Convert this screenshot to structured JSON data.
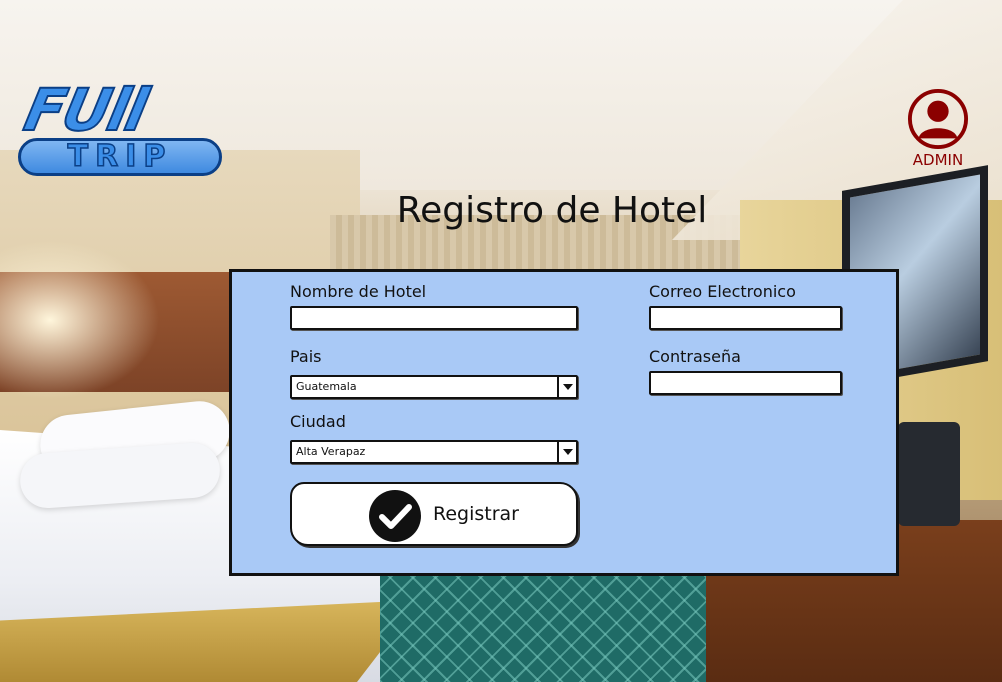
{
  "logo": {
    "line1": "FUll",
    "line2": "TRIP"
  },
  "admin": {
    "label": "ADMIN",
    "color": "#8b0000"
  },
  "page": {
    "title": "Registro de Hotel"
  },
  "form": {
    "hotel_name_label": "Nombre de Hotel",
    "hotel_name_value": "",
    "country_label": "Pais",
    "country_value": "Guatemala",
    "city_label": "Ciudad",
    "city_value": "Alta Verapaz",
    "email_label": "Correo Electronico",
    "email_value": "",
    "password_label": "Contraseña",
    "password_value": "",
    "submit_label": "Registrar",
    "panel_color": "#a9c9f6"
  }
}
